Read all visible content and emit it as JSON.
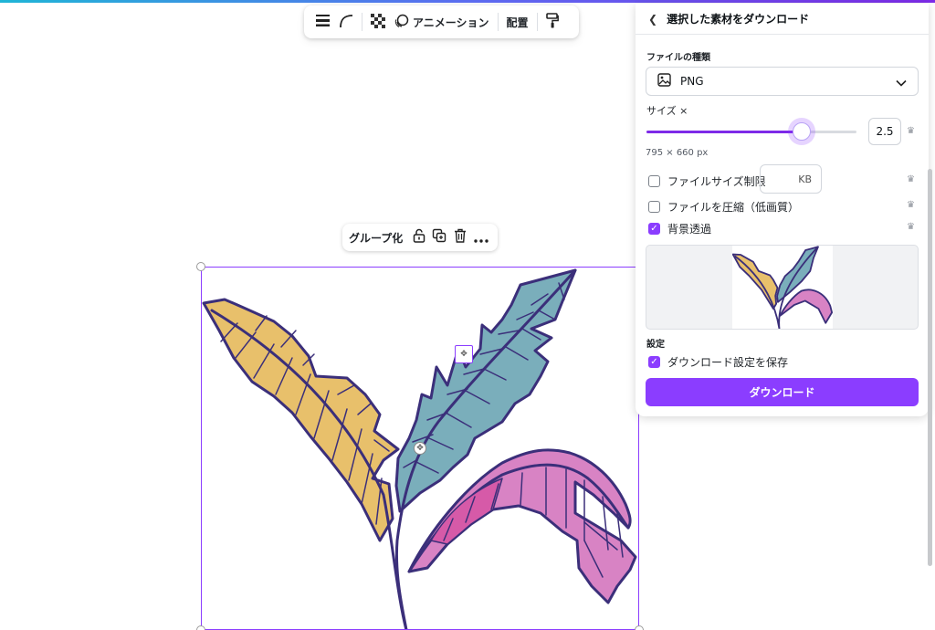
{
  "toolbar": {
    "animation_label": "アニメーション",
    "arrange_label": "配置"
  },
  "context_menu": {
    "group_label": "グループ化"
  },
  "panel": {
    "title": "選択した素材をダウンロード",
    "file_type_label": "ファイルの種類",
    "file_type_value": "PNG",
    "size_label": "サイズ ×",
    "size_value": "2.5",
    "size_slider_fraction": 0.74,
    "dimensions": "795 × 660 px",
    "file_size_limit_label": "ファイルサイズ制限",
    "kb_unit": "KB",
    "compress_label": "ファイルを圧縮（低画質）",
    "transparent_bg_label": "背景透過",
    "settings_label": "設定",
    "save_settings_label": "ダウンロード設定を保存",
    "download_button": "ダウンロード"
  },
  "checkboxes": {
    "file_size_limit": false,
    "compress": false,
    "transparent_bg": true,
    "save_settings": true
  },
  "colors": {
    "accent": "#8b3dff",
    "leaf_yellow": "#e8c06b",
    "leaf_teal": "#7aaebb",
    "leaf_pink": "#d883c4",
    "outline": "#3b2f7a"
  }
}
